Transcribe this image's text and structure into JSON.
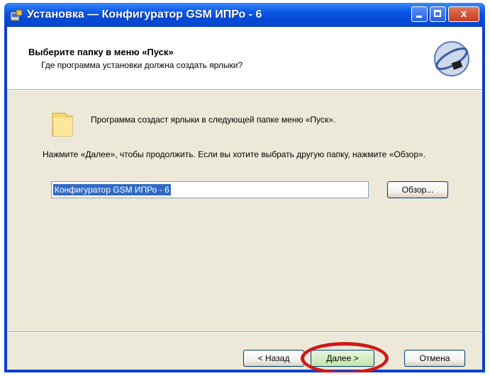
{
  "window": {
    "title": "Установка — Конфигуратор GSM ИПРо - 6",
    "close_glyph": "x"
  },
  "header": {
    "title": "Выберите папку в меню «Пуск»",
    "subtitle": "Где программа установки должна создать ярлыки?"
  },
  "body": {
    "info": "Программа создаст ярлыки в следующей папке меню «Пуск».",
    "instruction": "Нажмите «Далее», чтобы продолжить. Если вы хотите выбрать другую папку, нажмите «Обзор».",
    "folder_value": "Конфигуратор GSM ИПРо - 6",
    "browse_label": "Обзор..."
  },
  "footer": {
    "back_label": "< Назад",
    "next_label": "Далее >",
    "cancel_label": "Отмена"
  },
  "icons": {
    "app": "installer-icon",
    "folder": "folder-icon",
    "logo": "company-logo"
  },
  "colors": {
    "titlebar": "#0a46c8",
    "highlight": "#d01818",
    "selection": "#316ac5"
  }
}
